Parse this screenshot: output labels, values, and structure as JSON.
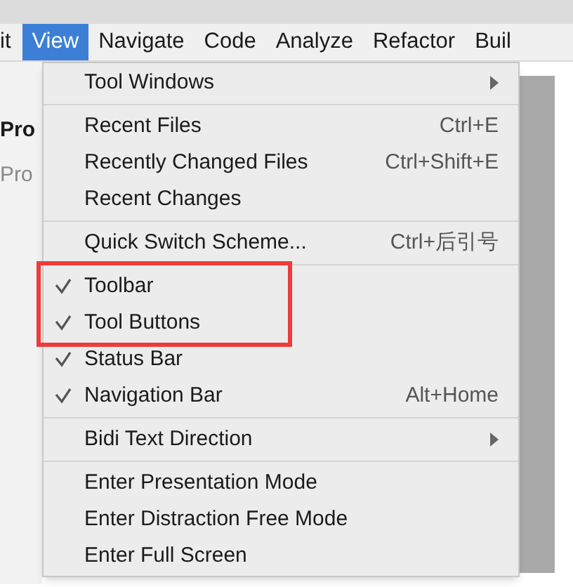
{
  "menu_bar": [
    {
      "label": "it",
      "selected": false
    },
    {
      "label": "View",
      "selected": true
    },
    {
      "label": "Navigate",
      "selected": false
    },
    {
      "label": "Code",
      "selected": false
    },
    {
      "label": "Analyze",
      "selected": false
    },
    {
      "label": "Refactor",
      "selected": false
    },
    {
      "label": "Buil",
      "selected": false
    }
  ],
  "side_panel": {
    "title": "Pro",
    "tab": "Pro"
  },
  "menu": {
    "groups": [
      [
        {
          "label": "Tool Windows",
          "kind": "submenu"
        }
      ],
      [
        {
          "label": "Recent Files",
          "kind": "action",
          "shortcut": "Ctrl+E"
        },
        {
          "label": "Recently Changed Files",
          "kind": "action",
          "shortcut": "Ctrl+Shift+E"
        },
        {
          "label": "Recent Changes",
          "kind": "action"
        }
      ],
      [
        {
          "label": "Quick Switch Scheme...",
          "kind": "action",
          "shortcut": "Ctrl+后引号"
        }
      ],
      [
        {
          "label": "Toolbar",
          "kind": "check",
          "checked": true,
          "highlighted": true
        },
        {
          "label": "Tool Buttons",
          "kind": "check",
          "checked": true,
          "highlighted": true
        },
        {
          "label": "Status Bar",
          "kind": "check",
          "checked": true,
          "highlighted": false
        },
        {
          "label": "Navigation Bar",
          "kind": "check",
          "checked": true,
          "highlighted": false,
          "shortcut": "Alt+Home"
        }
      ],
      [
        {
          "label": "Bidi Text Direction",
          "kind": "submenu"
        }
      ],
      [
        {
          "label": "Enter Presentation Mode",
          "kind": "action"
        },
        {
          "label": "Enter Distraction Free Mode",
          "kind": "action"
        },
        {
          "label": "Enter Full Screen",
          "kind": "action"
        }
      ]
    ]
  }
}
